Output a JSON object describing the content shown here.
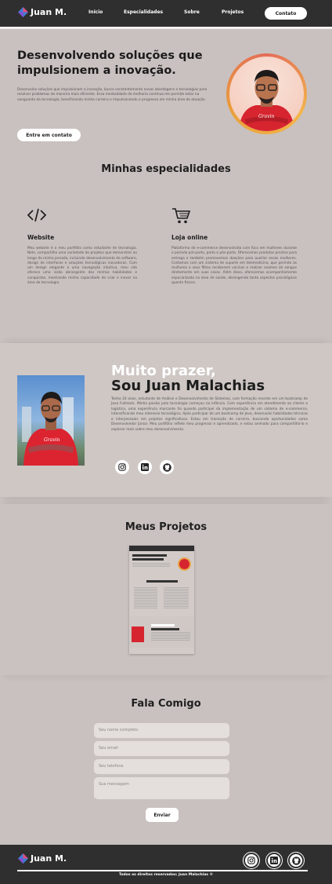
{
  "header": {
    "logo_text": "Juan M.",
    "nav": [
      "Início",
      "Especialidades",
      "Sobre",
      "Projetos"
    ],
    "contact_button": "Contato"
  },
  "hero": {
    "title": "Desenvolvendo soluções que impulsionem a inovação.",
    "description": "Desenvolvo soluções que impulsionam a inovação, busco constantemente novas abordagens e tecnologias para resolver problemas de maneira mais eficiente. Essa mentalidade de melhoria contínua me permite estar na vanguarda da tecnologia, beneficiando minha carreira e impulsionando o progresso em minha área de atuação.",
    "cta": "Entre em contato"
  },
  "specialties": {
    "title": "Minhas especialidades",
    "items": [
      {
        "icon": "code-icon",
        "title": "Website",
        "description": "Meu website é o meu portfólio como estudante de tecnologia. Nele, compartilho uma variedade de projetos que demonstrei ao longo da minha jornada, incluindo desenvolvimento de software, design de interfaces e soluções tecnológicas inovadoras. Com um design elegante e uma navegação intuitiva, meu site oferece uma visão abrangente das minhas habilidades e conquistas, mostrando minha capacidade de criar e inovar na área de tecnologia."
      },
      {
        "icon": "shopping-cart-icon",
        "title": "Loja online",
        "description": "Plataforma de e-commerce desenvolvida com foco em mulheres durante o período pré-parto, parto e pós-parto. Oferecemos produtos prontos para entrega e também promovemos doações para auxiliar essas mulheres. Contamos com um sistema de suporte em telemedicina, que permite às mulheres e seus filhos receberem vacinas e realizar exames de sangue diretamente em suas casas. Além disso, oferecemos acompanhamento especializado na área de saúde, abrangendo tanto aspectos psicológicos quanto físicos."
      }
    ]
  },
  "about": {
    "greeting": "Muito prazer,",
    "name": "Sou Juan Malachias",
    "text": "Tenho 24 anos, estudante de Análise e Desenvolvimento de Sistemas, com formação recente em um bootcamp de Java Fullstack. Minha paixão pela tecnologia começou na infância. Com experiência em atendimento ao cliente e logística, uma experiência marcante foi quando participei da implementação de um sistema de e-commerce, intensificando meu interesse tecnológico. Após participar de um bootcamp de Java, desenvolvi habilidades técnicas e interpessoais em projetos significativos. Estou em transição de carreira, buscando oportunidades como Desenvolvedor Júnior. Meu portfólio reflete meu progresso e aprendizado, e estou animado para compartilhá-lo e explorar mais sobre meu desenvolvimento.",
    "socials": [
      "instagram-icon",
      "linkedin-icon",
      "github-icon"
    ]
  },
  "projects": {
    "title": "Meus Projetos"
  },
  "contact": {
    "title": "Fala Comigo",
    "fields": {
      "name_placeholder": "Seu nome completo",
      "email_placeholder": "Seu email",
      "phone_placeholder": "Seu telefone",
      "message_placeholder": "Sua mensagem"
    },
    "submit": "Enviar"
  },
  "footer": {
    "logo_text": "Juan M.",
    "copyright": "Todos os direitos reservados: Juan Malachias ®",
    "socials": [
      "instagram-icon",
      "linkedin-icon",
      "github-icon"
    ]
  },
  "colors": {
    "header_bg": "#2f2f2f",
    "page_bg": "#c9c1bf",
    "accent_red": "#e0202e",
    "ring_orange": "#f2b64a"
  }
}
